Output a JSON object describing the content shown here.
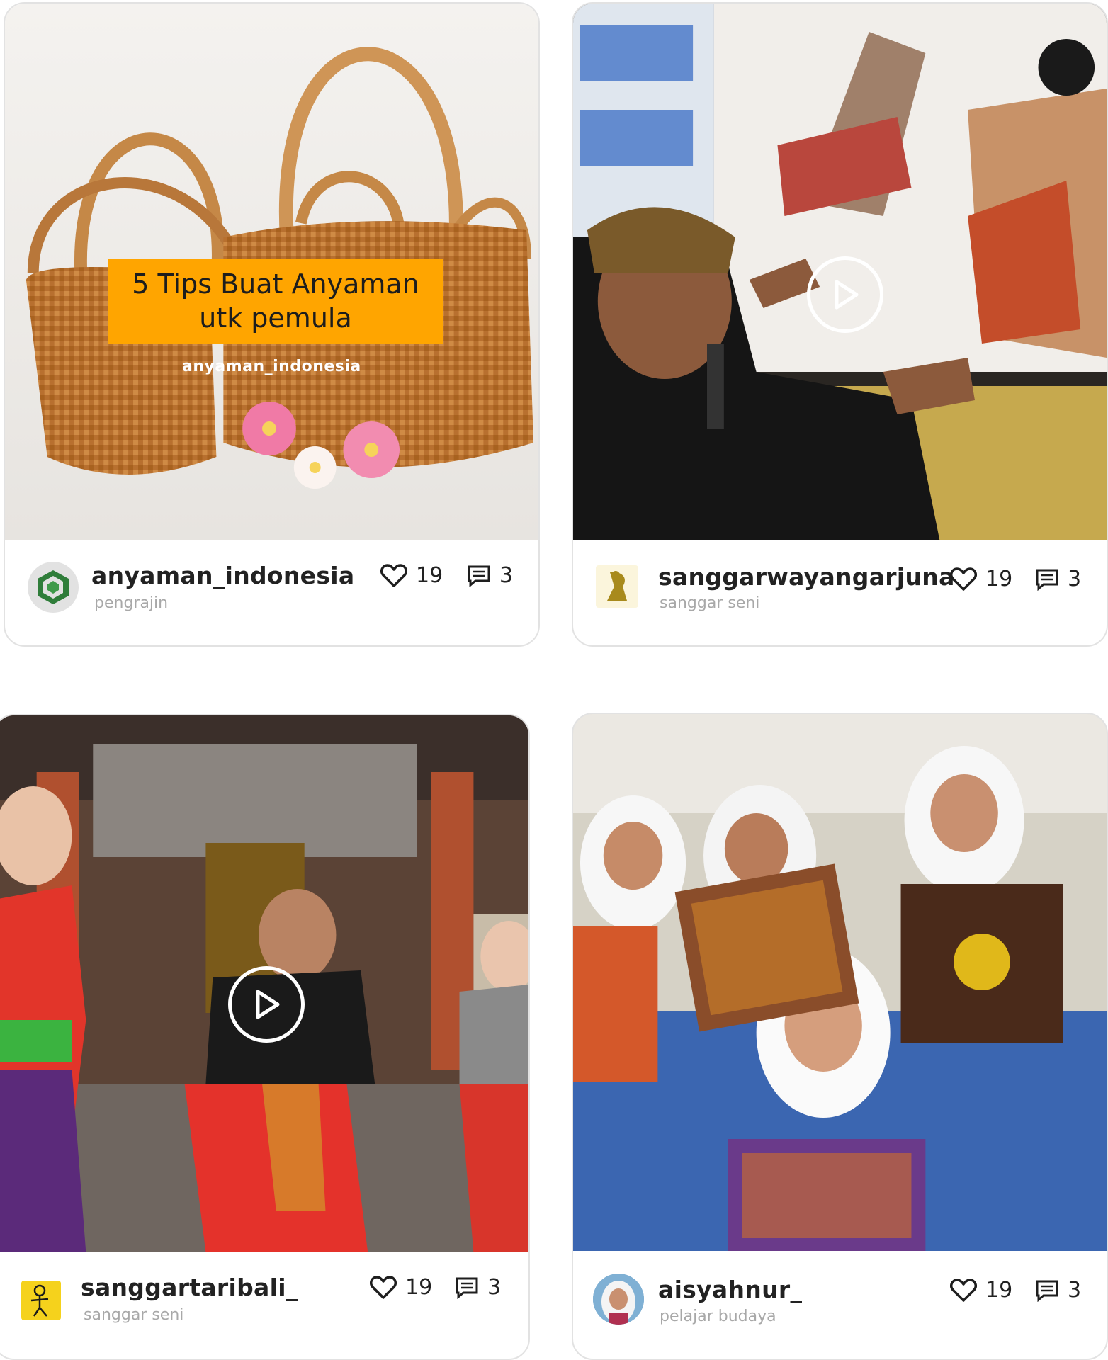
{
  "posts": [
    {
      "username": "anyaman_indonesia",
      "role": "pengrajin",
      "likes": "19",
      "comments": "3",
      "overlay_title": "5 Tips Buat Anyaman utk pemula",
      "overlay_handle": "anyaman_indonesia",
      "media_type": "image",
      "avatar_icon": "woven-logo-icon"
    },
    {
      "username": "sanggarwayangarjuna",
      "role": "sanggar seni",
      "likes": "19",
      "comments": "3",
      "media_type": "video",
      "avatar_icon": "wayang-logo-icon"
    },
    {
      "username": "sanggartaribali_",
      "role": "sanggar seni",
      "likes": "19",
      "comments": "3",
      "media_type": "video",
      "avatar_icon": "dancer-logo-icon"
    },
    {
      "username": "aisyahnur_",
      "role": "pelajar budaya",
      "likes": "19",
      "comments": "3",
      "media_type": "image",
      "avatar_icon": "profile-photo"
    }
  ],
  "icons": {
    "like": "heart-icon",
    "comment": "comment-icon",
    "play": "play-icon"
  },
  "colors": {
    "overlay_badge": "#ffa500",
    "card_border": "#e2e2e2",
    "muted_text": "#a8a8a8"
  }
}
